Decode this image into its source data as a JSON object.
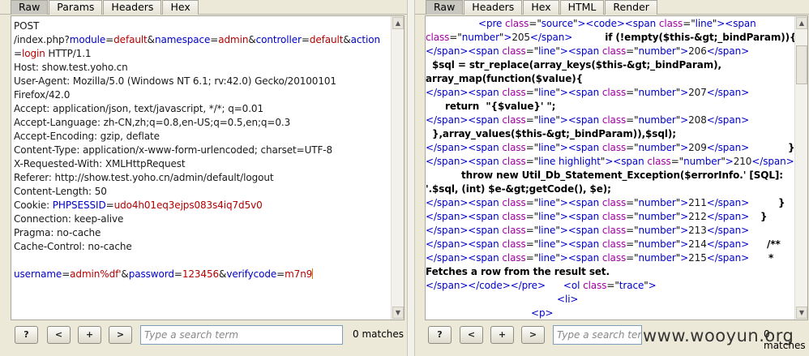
{
  "left": {
    "tabs": [
      "Raw",
      "Params",
      "Headers",
      "Hex"
    ],
    "request": {
      "line1": "POST",
      "path": "/index.php?",
      "params": [
        {
          "k": "module",
          "v": "default"
        },
        {
          "k": "namespace",
          "v": "admin"
        },
        {
          "k": "controller",
          "v": "default"
        },
        {
          "k": "action",
          "v": "login"
        }
      ],
      "protocol": " HTTP/1.1",
      "headers": [
        "Host: show.test.yoho.cn",
        "User-Agent: Mozilla/5.0 (Windows NT 6.1; rv:42.0) Gecko/20100101",
        "Firefox/42.0",
        "Accept: application/json, text/javascript, */*; q=0.01",
        "Accept-Language: zh-CN,zh;q=0.8,en-US;q=0.5,en;q=0.3",
        "Accept-Encoding: gzip, deflate",
        "Content-Type: application/x-www-form-urlencoded; charset=UTF-8",
        "X-Requested-With: XMLHttpRequest",
        "Referer: http://show.test.yoho.cn/admin/default/logout",
        "Content-Length: 50"
      ],
      "cookie_label": "Cookie: ",
      "cookie_name": "PHPSESSID",
      "cookie_value": "udo4h01eq3ejps083s4iq7d5v0",
      "headers2": [
        "Connection: keep-alive",
        "Pragma: no-cache",
        "Cache-Control: no-cache"
      ],
      "body": [
        {
          "k": "username",
          "v": "admin%df'"
        },
        {
          "k": "password",
          "v": "123456"
        },
        {
          "k": "verifycode",
          "v": "m7n9"
        }
      ]
    },
    "search_placeholder": "Type a search term",
    "matches": "0 matches",
    "buttons": [
      "?",
      "<",
      "+",
      ">"
    ]
  },
  "right": {
    "tabs": [
      "Raw",
      "Headers",
      "Hex",
      "HTML",
      "Render"
    ],
    "search_placeholder": "Type a search term",
    "matches": "0 matches",
    "buttons": [
      "?",
      "<",
      "+",
      ">"
    ],
    "code": {
      "n205": "205",
      "n206": "206",
      "n207": "207",
      "n208": "208",
      "n209": "209",
      "n210": "210",
      "n211": "211",
      "n212": "212",
      "n213": "213",
      "n214": "214",
      "n215": "215",
      "c1": "if (!empty($this-&gt;_bindParam)){",
      "c2": "$sql = str_replace(array_keys($this-&gt;_bindParam),",
      "c3": "array_map(function($value){",
      "c4": "return  \"{$value}' \";",
      "c5": "},array_values($this-&gt;_bindParam)),$sql);",
      "c6": "}",
      "c7": "throw new Util_Db_Statement_Exception($errorInfo.' [SQL]:",
      "c8": "'.$sql, (int) $e-&gt;getCode(), $e);",
      "c9": "}",
      "c10": "}",
      "c11": "/**",
      "c12": "*",
      "c13": "Fetches a row from the result set.",
      "source": "source",
      "line": "line",
      "number": "number",
      "highlight": "line highlight",
      "trace": "trace"
    }
  },
  "watermark": "www.wooyun.org"
}
